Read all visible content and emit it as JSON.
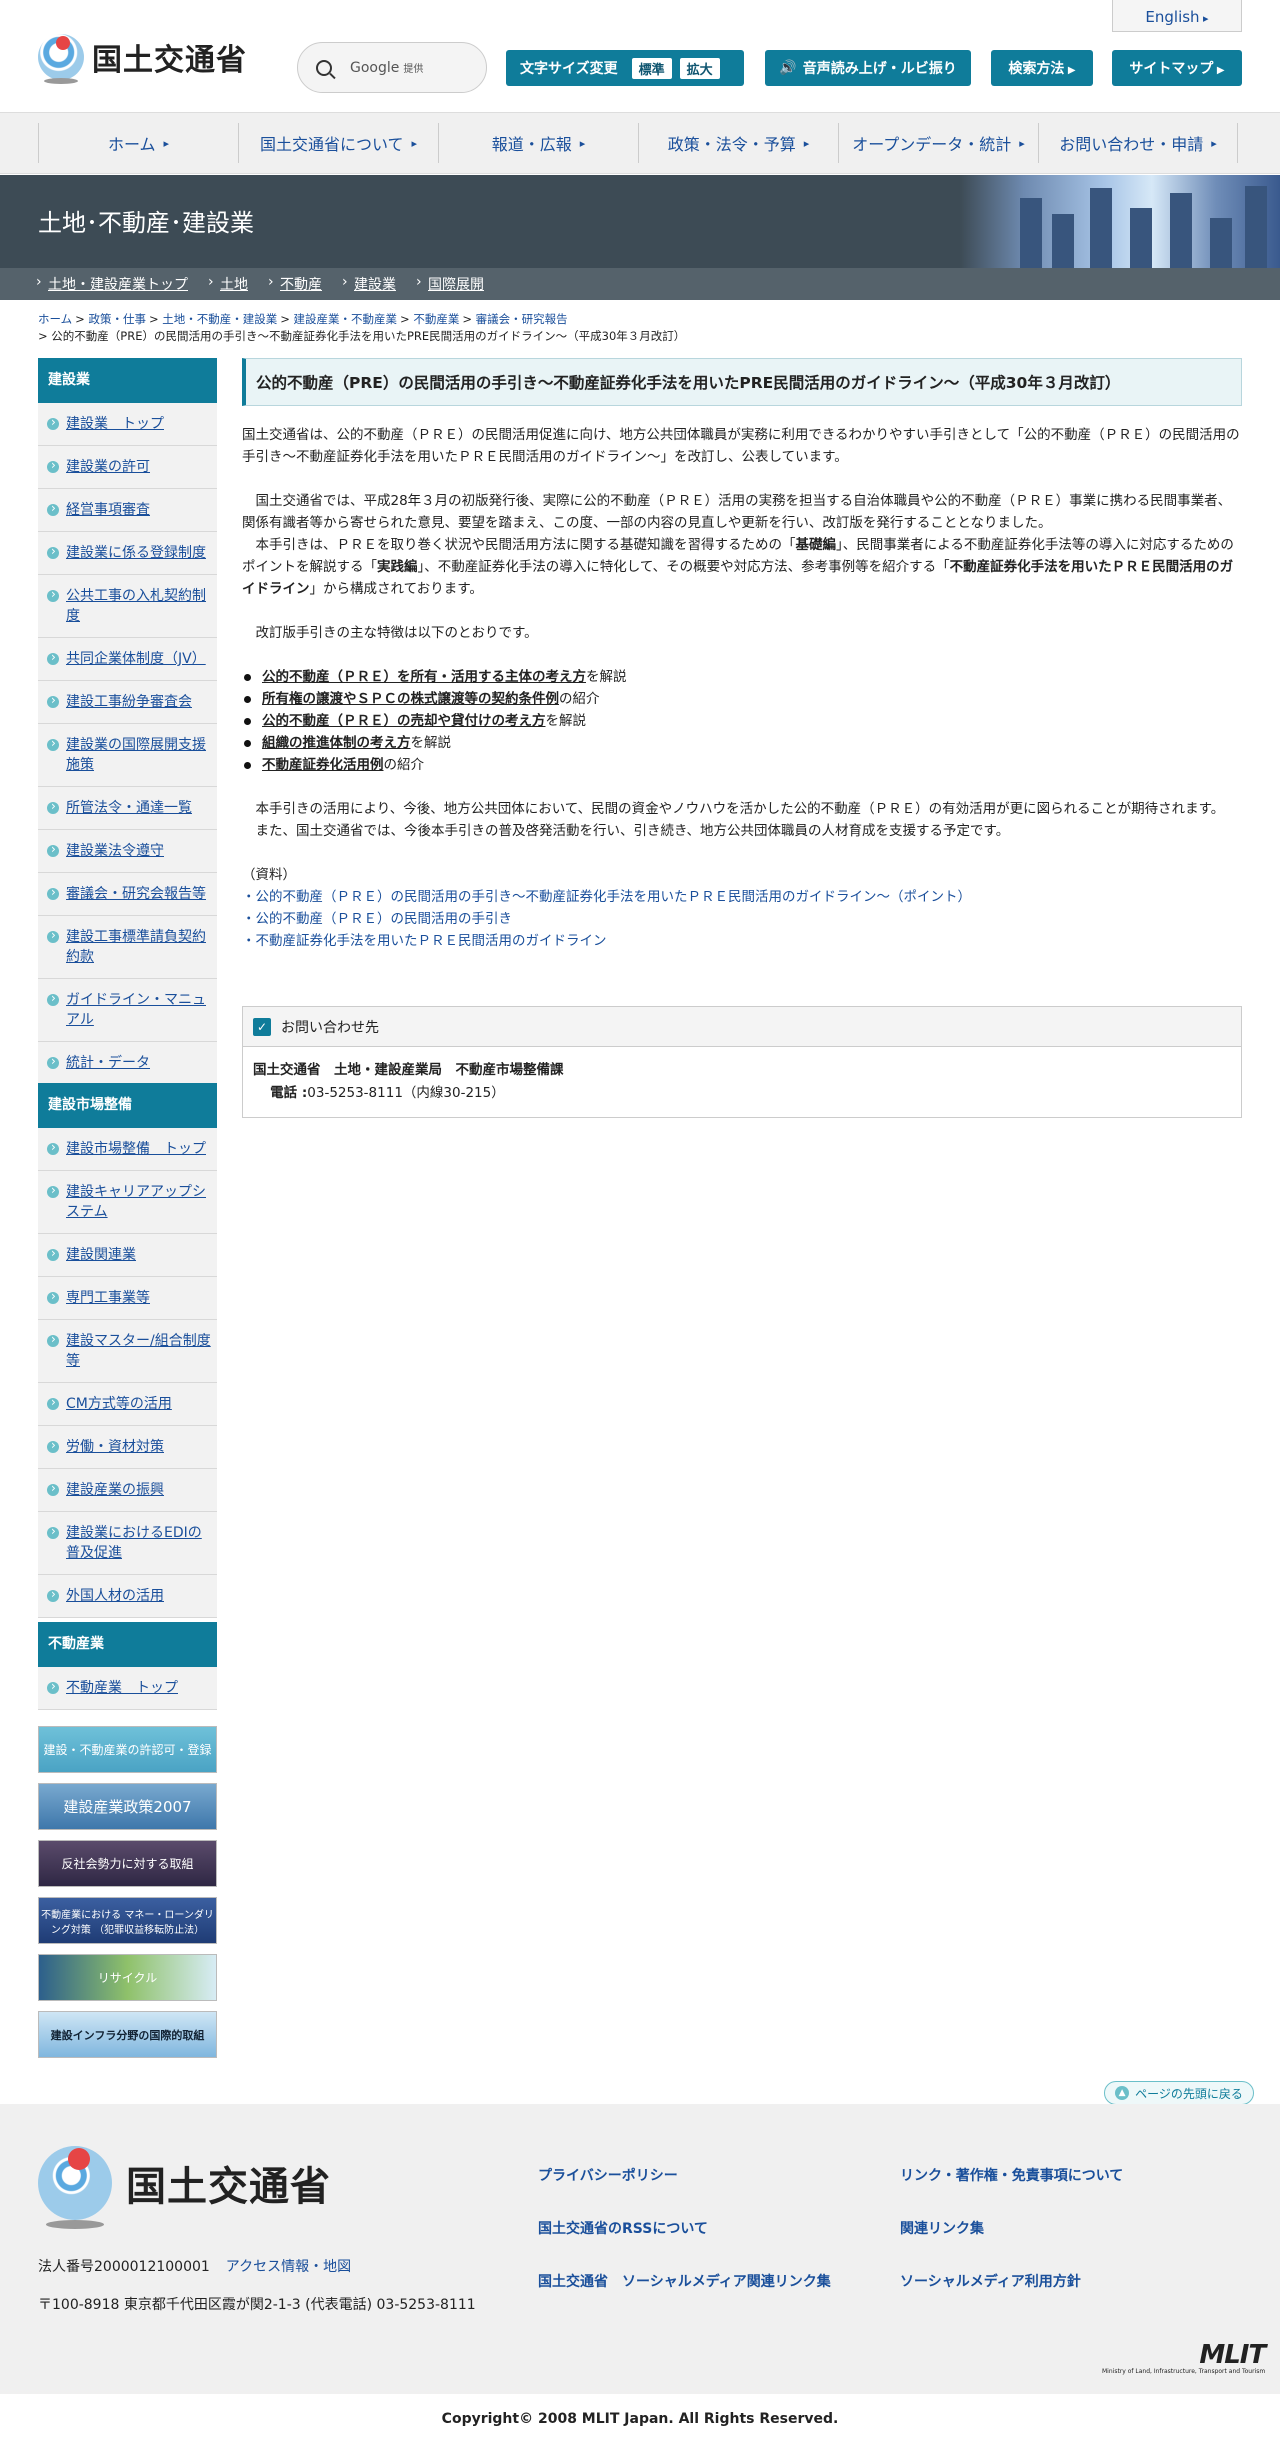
{
  "header": {
    "english": "English",
    "logo_text": "国土交通省",
    "search_label": "Google",
    "search_small": "提供",
    "font_size_label": "文字サイズ変更",
    "font_std": "標準",
    "font_large": "拡大",
    "voice": "音声読み上げ・ルビ振り",
    "search_method": "検索方法",
    "sitemap": "サイトマップ"
  },
  "gnav": [
    "ホーム",
    "国土交通省について",
    "報道・広報",
    "政策・法令・予算",
    "オープンデータ・統計",
    "お問い合わせ・申請"
  ],
  "banner_title": "土地･不動産･建設業",
  "subnav": [
    "土地・建設産業トップ",
    "土地",
    "不動産",
    "建設業",
    "国際展開"
  ],
  "crumbs": {
    "items": [
      "ホーム",
      "政策・仕事",
      "土地・不動産・建設業",
      "建設産業・不動産業",
      "不動産業",
      "審議会・研究報告"
    ],
    "sep": ">",
    "current": "> 公的不動産（PRE）の民間活用の手引き～不動産証券化手法を用いたPRE民間活用のガイドライン～（平成30年３月改訂）"
  },
  "sidebar": {
    "kensetsu": {
      "head": "建設業",
      "items": [
        "建設業　トップ",
        "建設業の許可",
        "経営事項審査",
        "建設業に係る登録制度",
        "公共工事の入札契約制度",
        "共同企業体制度（JV）",
        "建設工事紛争審査会",
        "建設業の国際展開支援施策",
        "所管法令・通達一覧",
        "建設業法令遵守",
        "審議会・研究会報告等",
        "建設工事標準請負契約約款",
        "ガイドライン・マニュアル",
        "統計・データ"
      ]
    },
    "shijo": {
      "head": "建設市場整備",
      "items": [
        "建設市場整備　トップ",
        "建設キャリアアップシステム",
        "建設関連業",
        "専門工事業等",
        "建設マスター/組合制度等",
        "CM方式等の活用",
        "労働・資材対策",
        "建設産業の振興",
        "建設業におけるEDIの普及促進",
        "外国人材の活用"
      ]
    },
    "fudosan": {
      "head": "不動産業",
      "items": [
        "不動産業　トップ"
      ]
    }
  },
  "banners": [
    "建設・不動産業の許認可・登録",
    "建設産業政策2007",
    "反社会勢力に対する取組",
    "不動産業における マネー・ローンダリング対策 （犯罪収益移転防止法）",
    "リサイクル",
    "建設インフラ分野の国際的取組"
  ],
  "main": {
    "title": "公的不動産（PRE）の民間活用の手引き～不動産証券化手法を用いたPRE民間活用のガイドライン～（平成30年３月改訂）",
    "p1": "国土交通省は、公的不動産（ＰＲＥ）の民間活用促進に向け、地方公共団体職員が実務に利用できるわかりやすい手引きとして「公的不動産（ＰＲＥ）の民間活用の手引き～不動産証券化手法を用いたＰＲＥ民間活用のガイドライン～」を改訂し、公表しています。",
    "p2": "　国土交通省では、平成28年３月の初版発行後、実際に公的不動産（ＰＲＥ）活用の実務を担当する自治体職員や公的不動産（ＰＲＥ）事業に携わる民間事業者、関係有識者等から寄せられた意見、要望を踏まえ、この度、一部の内容の見直しや更新を行い、改訂版を発行することとなりました。",
    "p3a": "　本手引きは、ＰＲＥを取り巻く状況や民間活用方法に関する基礎知識を習得するための「",
    "p3b": "基礎編",
    "p3c": "」、民間事業者による不動産証券化手法等の導入に対応するためのポイントを解説する「",
    "p3d": "実践編",
    "p3e": "」、不動産証券化手法の導入に特化して、その概要や対応方法、参考事例等を紹介する「",
    "p3f": "不動産証券化手法を用いたＰＲＥ民間活用のガイドライン",
    "p3g": "」から構成されております。",
    "p4": "　改訂版手引きの主な特徴は以下のとおりです。",
    "features": [
      {
        "b": "公的不動産（ＰＲＥ）を所有・活用する主体の考え方",
        "t": "を解説"
      },
      {
        "b": "所有権の譲渡やＳＰＣの株式譲渡等の契約条件例",
        "t": "の紹介"
      },
      {
        "b": "公的不動産（ＰＲＥ）の売却や貸付けの考え方",
        "t": "を解説"
      },
      {
        "b": "組織の推進体制の考え方",
        "t": "を解説"
      },
      {
        "b": "不動産証券化活用例",
        "t": "の紹介"
      }
    ],
    "p5": "　本手引きの活用により、今後、地方公共団体において、民間の資金やノウハウを活かした公的不動産（ＰＲＥ）の有効活用が更に図られることが期待されます。",
    "p6": "　また、国土交通省では、今後本手引きの普及啓発活動を行い、引き続き、地方公共団体職員の人材育成を支援する予定です。",
    "res_label": "（資料）",
    "res": [
      "・公的不動産（ＰＲＥ）の民間活用の手引き～不動産証券化手法を用いたＰＲＥ民間活用のガイドライン～（ポイント）",
      "・公的不動産（ＰＲＥ）の民間活用の手引き",
      "・不動産証券化手法を用いたＰＲＥ民間活用のガイドライン"
    ],
    "contact_head": "お問い合わせ先",
    "contact_org": "国土交通省　土地・建設産業局　不動産市場整備課",
    "contact_tel_label": "電話 :",
    "contact_tel": "03-5253-8111（内線30-215）"
  },
  "pagetop": "ページの先頭に戻る",
  "footer": {
    "logo_text": "国土交通省",
    "corp": "法人番号2000012100001",
    "access": "アクセス情報・地図",
    "addr": "〒100-8918 東京都千代田区霞が関2-1-3 (代表電話) 03-5253-8111",
    "links": [
      "プライバシーポリシー",
      "リンク・著作権・免責事項について",
      "国土交通省のRSSについて",
      "関連リンク集",
      "国土交通省　ソーシャルメディア関連リンク集",
      "ソーシャルメディア利用方針"
    ],
    "mlit": "MLIT",
    "mlit_small": "Ministry of Land, Infrastructure, Transport and Tourism",
    "copyright": "Copyright© 2008 MLIT Japan. All Rights Reserved."
  }
}
